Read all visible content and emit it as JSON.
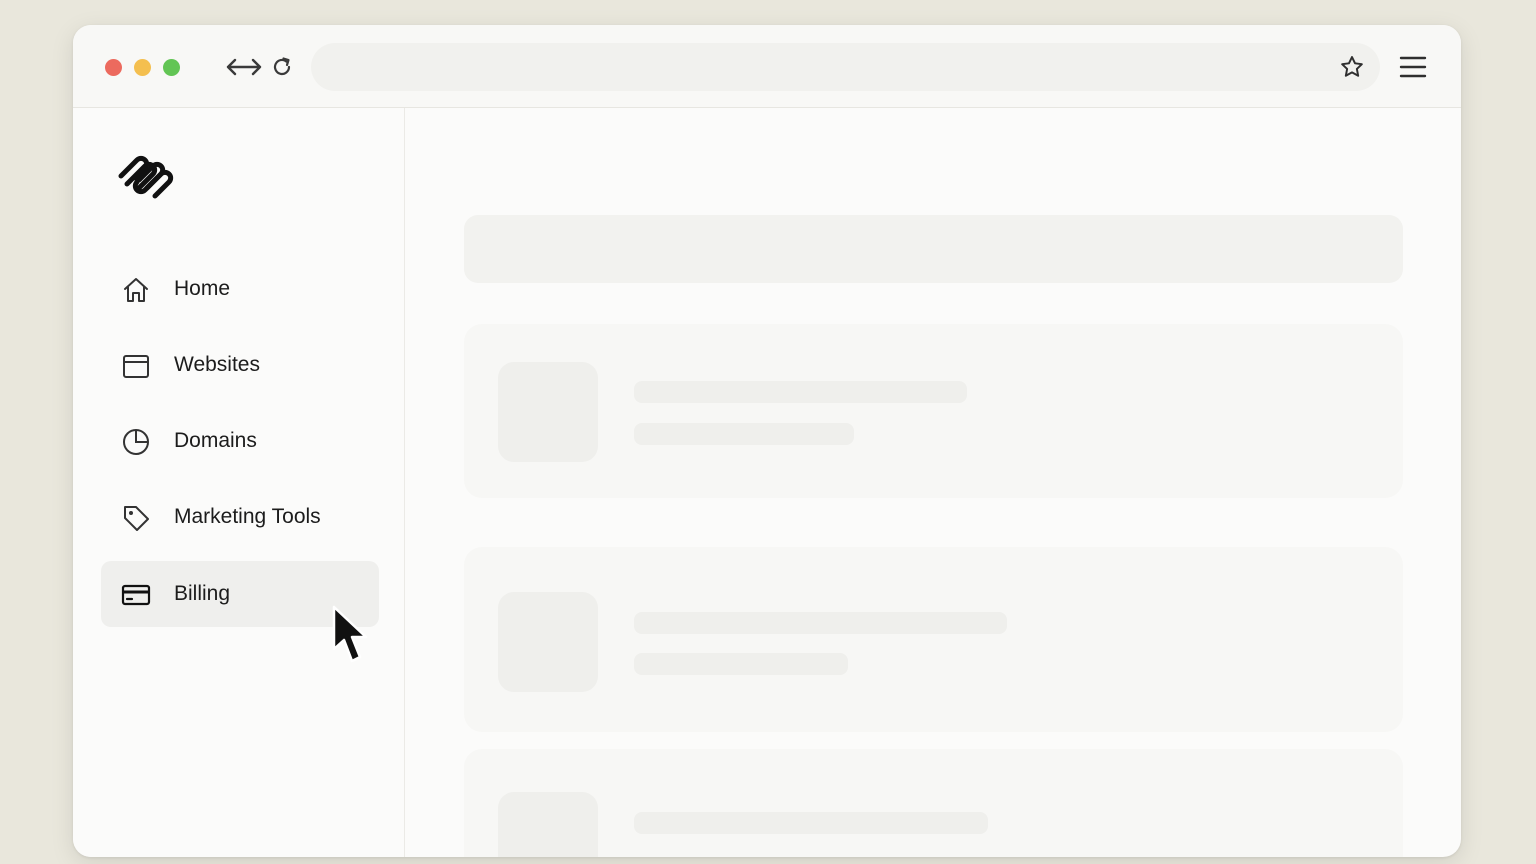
{
  "browser": {
    "title_bar": "",
    "address_bar_value": "",
    "icons": [
      "swap-arrows-icon",
      "reload-icon",
      "bookmark-star-icon",
      "hamburger-menu-icon"
    ]
  },
  "brand": {
    "logo": "squarespace-logo"
  },
  "sidebar": {
    "items": [
      {
        "label": "Home",
        "icon": "home-icon",
        "active": false
      },
      {
        "label": "Websites",
        "icon": "browser-window-icon",
        "active": false
      },
      {
        "label": "Domains",
        "icon": "pie-clock-icon",
        "active": false
      },
      {
        "label": "Marketing Tools",
        "icon": "tag-icon",
        "active": false
      },
      {
        "label": "Billing",
        "icon": "credit-card-icon",
        "active": true
      }
    ]
  },
  "main": {
    "state": "loading-skeleton"
  },
  "colors": {
    "page_bg": "#e9e7dc",
    "window_bg": "#fbfbfa",
    "active_item_bg": "#efefed",
    "traffic_red": "#ec6a5e",
    "traffic_yellow": "#f4bf4f",
    "traffic_green": "#62c554"
  }
}
